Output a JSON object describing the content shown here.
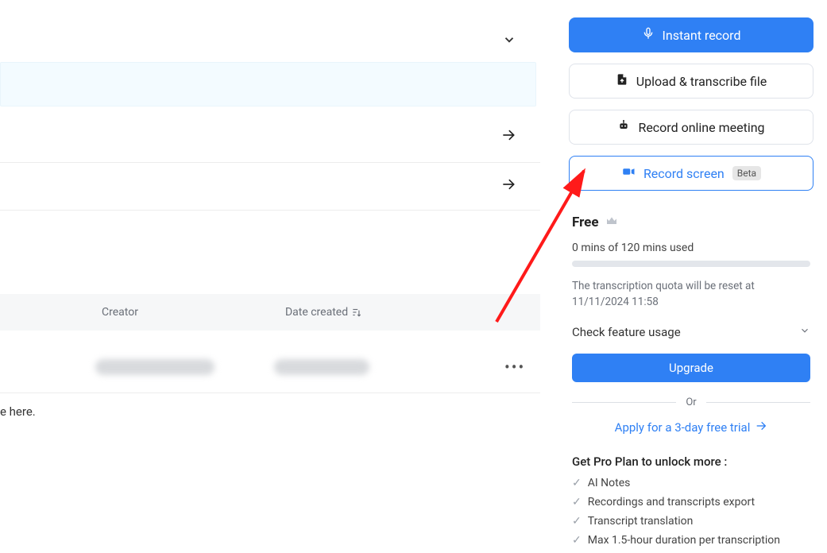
{
  "side": {
    "instant_record": "Instant record",
    "upload": "Upload & transcribe file",
    "online_meeting": "Record online meeting",
    "record_screen": "Record screen",
    "beta": "Beta"
  },
  "plan": {
    "name": "Free",
    "usage": "0 mins of 120 mins used",
    "quota_note": "The transcription quota will be reset at 11/11/2024 11:58",
    "check_usage": "Check feature usage",
    "upgrade": "Upgrade",
    "or": "Or",
    "trial": "Apply for a 3-day free trial",
    "pro_title": "Get Pro Plan to unlock more :",
    "features": [
      "AI Notes",
      "Recordings and transcripts export",
      "Transcript translation",
      "Max 1.5-hour duration per transcription"
    ]
  },
  "main": {
    "columns": {
      "creator": "Creator",
      "date_created": "Date created"
    },
    "empty_hint": "e here."
  }
}
